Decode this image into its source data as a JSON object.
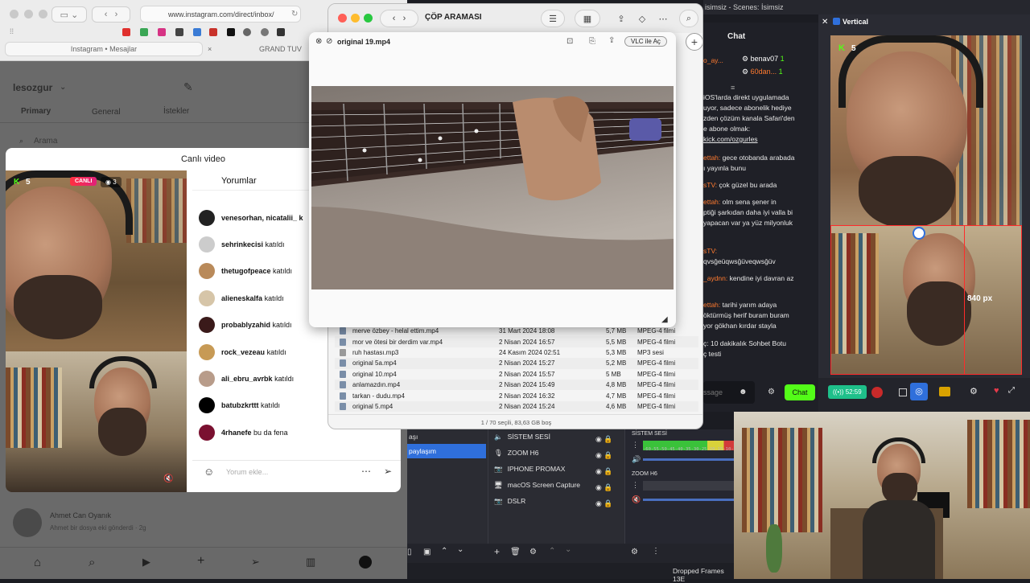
{
  "safari": {
    "url": "www.instagram.com/direct/inbox/",
    "tabs": [
      "Instagram • Mesajlar",
      "GRAND TUV"
    ]
  },
  "instagram": {
    "username": "lesozgur",
    "inbox_tabs": [
      "Primary",
      "General",
      "İstekler"
    ],
    "search_placeholder": "Arama",
    "live_title": "Canlı video",
    "live_badge": "CANLI",
    "viewer_count": "3",
    "kick_count": "5",
    "comments_header": "Yorumlar",
    "comments": [
      {
        "user": "venesorhan, nicatalii_ k",
        "text": ""
      },
      {
        "user": "sehrinkecisi",
        "text": "katıldı"
      },
      {
        "user": "thetugofpeace",
        "text": "katıldı"
      },
      {
        "user": "alieneskalfa",
        "text": "katıldı"
      },
      {
        "user": "probablyzahid",
        "text": "katıldı"
      },
      {
        "user": "rock_vezeau",
        "text": "katıldı"
      },
      {
        "user": "ali_ebru_avrbk",
        "text": "katıldı"
      },
      {
        "user": "batubzkrttt",
        "text": "katıldı"
      },
      {
        "user": "4rhanefe",
        "text": "bu da fena"
      }
    ],
    "comment_placeholder": "Yorum ekle...",
    "dm": {
      "name": "Ahmet Can Oyanık",
      "preview": "Ahmet bir dosya eki gönderdi · 2g"
    }
  },
  "finder": {
    "title": "ÇÖP ARAMASI",
    "status": "1 / 70 seçili, 83,63 GB boş",
    "files": [
      {
        "name": "merve özbey - helal ettim.mp4",
        "date": "31 Mart 2024 18:08",
        "size": "5,7 MB",
        "kind": "MPEG-4 filmi"
      },
      {
        "name": "mor ve ötesi bir derdim var.mp4",
        "date": "2 Nisan 2024 16:57",
        "size": "5,5 MB",
        "kind": "MPEG-4 filmi"
      },
      {
        "name": "ruh hastası.mp3",
        "date": "24 Kasım 2024 02:51",
        "size": "5,3 MB",
        "kind": "MP3 sesi"
      },
      {
        "name": "original 5a.mp4",
        "date": "2 Nisan 2024 15:27",
        "size": "5,2 MB",
        "kind": "MPEG-4 filmi"
      },
      {
        "name": "original 10.mp4",
        "date": "2 Nisan 2024 15:57",
        "size": "5 MB",
        "kind": "MPEG-4 filmi"
      },
      {
        "name": "anlamazdın.mp4",
        "date": "2 Nisan 2024 15:49",
        "size": "4,8 MB",
        "kind": "MPEG-4 filmi"
      },
      {
        "name": "tarkan - dudu.mp4",
        "date": "2 Nisan 2024 16:32",
        "size": "4,7 MB",
        "kind": "MPEG-4 filmi"
      },
      {
        "name": "original 5.mp4",
        "date": "2 Nisan 2024 15:24",
        "size": "4,6 MB",
        "kind": "MPEG-4 filmi"
      }
    ]
  },
  "quicklook": {
    "filename": "original 19.mp4",
    "open_with": "VLC ile Aç"
  },
  "obs": {
    "window_title": "isimsiz - Scenes: İsimsiz",
    "chat_title": "Chat",
    "chat_users": [
      {
        "name": "benav07",
        "count": "1"
      },
      {
        "name": "60dan...",
        "count": "1"
      }
    ],
    "chat_user_prefix": "o_ay...",
    "chat_lines": [
      {
        "who": "",
        "text": "iOS'larda direkt uygulamada"
      },
      {
        "who": "",
        "text": "uyor, sadece abonelik hediye"
      },
      {
        "who": "",
        "text": "zden çözüm kanala Safari'den"
      },
      {
        "who": "",
        "text": "e abone olmak:"
      },
      {
        "who": "",
        "text": "kick.com/ozgurles"
      },
      {
        "who": "ettah:",
        "text": "gece otobanda arabada"
      },
      {
        "who": "",
        "text": "ı yayınla bunu"
      },
      {
        "who": "sTV:",
        "text": "çok güzel bu arada"
      },
      {
        "who": "ettah:",
        "text": "olm sena şener in"
      },
      {
        "who": "",
        "text": "ptiği şarkıdan daha iyi valla bi"
      },
      {
        "who": "",
        "text": "yapacan var ya yüz milyonluk"
      },
      {
        "who": "sTV:",
        "text": ""
      },
      {
        "who": "",
        "text": "qvsğeüqwsğüveqwsğüv"
      },
      {
        "who": "_aydnn:",
        "text": "kendine iyi davran az"
      },
      {
        "who": "ettah:",
        "text": "tarihi yarım adaya"
      },
      {
        "who": "",
        "text": "öktürmüş herif buram buram"
      },
      {
        "who": "",
        "text": "yor gökhan kırdar stayla"
      },
      {
        "who": "",
        "text": "ç: 10 dakikalık Sohbet Botu"
      },
      {
        "who": "",
        "text": "ç testi"
      }
    ],
    "chat_placeholder": "ssage",
    "chat_send": "Chat",
    "vertical_title": "Vertical",
    "vertical_kick": "5",
    "height_label": "840 px",
    "timer": "52:59",
    "sources": [
      "SİSTEM SESİ",
      "ZOOM H6",
      "IPHONE PROMAX",
      "macOS Screen Capture",
      "DSLR"
    ],
    "scene_labels": [
      "aşı",
      "paylaşım"
    ],
    "mixer": [
      "SİSTEM SESİ",
      "ZOOM H6"
    ],
    "meter_ticks": [
      "-60",
      "-55",
      "-50",
      "-45",
      "-40",
      "-35",
      "-30",
      "-25",
      "-20",
      "-15",
      "-10",
      "-5"
    ],
    "status": "Dropped Frames 13E"
  },
  "colors": {
    "kick_green": "#53fc18",
    "live_red": "#ff3040",
    "obs_blue": "#2f6fdb",
    "chat_green": "#53fc18"
  }
}
